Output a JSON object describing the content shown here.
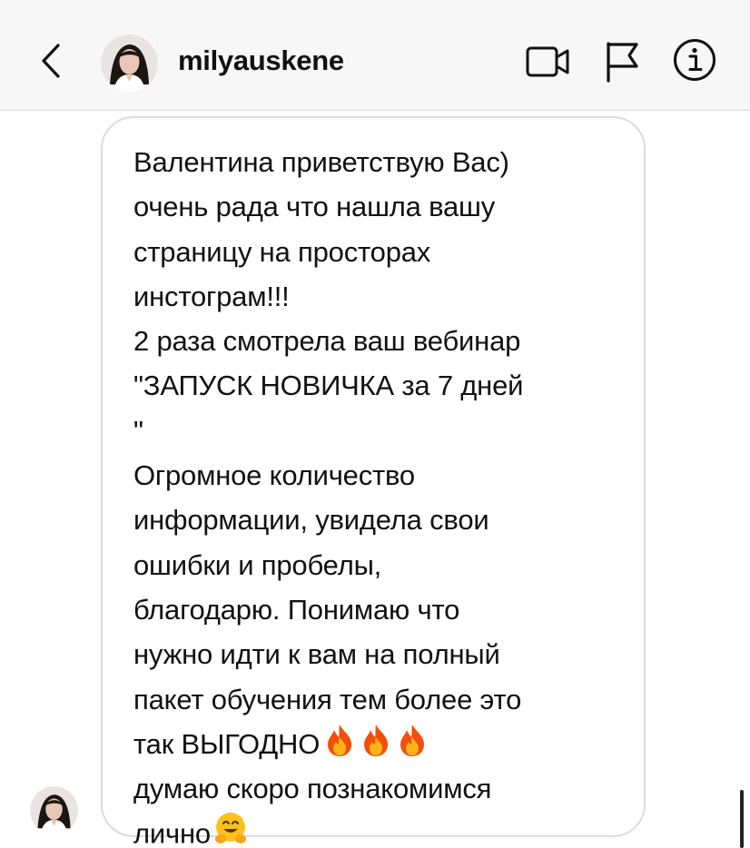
{
  "header": {
    "username": "milyauskene",
    "icons": {
      "back": "chevron-left-icon",
      "video": "video-camera-icon",
      "report": "flag-icon",
      "info": "info-icon"
    }
  },
  "message": {
    "lines": [
      "Валентина приветствую Вас)",
      "очень рада что нашла вашу",
      "страницу на просторах",
      "инстограм!!!",
      "2 раза смотрела ваш вебинар",
      "\"ЗАПУСК НОВИЧКА за 7 дней",
      "\"",
      "Огромное количество",
      "информации, увидела свои",
      "ошибки и пробелы,",
      "благодарю. Понимаю что",
      "нужно идти к вам на полный",
      "пакет обучения тем более это",
      "так ВЫГОДНО",
      "думаю скоро познакомимся",
      "лично"
    ],
    "emojis": {
      "after_line_14": [
        "fire-emoji",
        "fire-emoji",
        "fire-emoji"
      ],
      "after_line_16": [
        "hugging-face-emoji"
      ]
    }
  },
  "colors": {
    "header_bg": "#f7f7f7",
    "bubble_border": "#dcdcdc",
    "text": "#111111"
  }
}
